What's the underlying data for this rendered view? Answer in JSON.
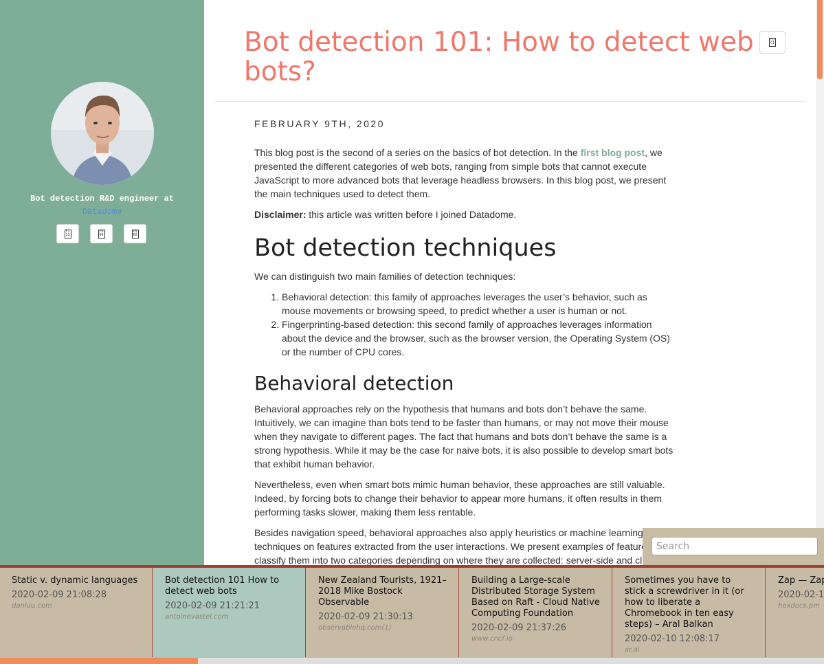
{
  "sidebar": {
    "tagline": "Bot detection R&D engineer at",
    "employer_link": "Datadome",
    "social_icons": [
      "github-icon",
      "twitter-icon",
      "linkedin-icon"
    ]
  },
  "article": {
    "title": "Bot detection 101: How to detect web bots?",
    "date": "FEBRUARY 9TH, 2020",
    "intro_before_link": "This blog post is the second of a series on the basics of bot detection. In the ",
    "intro_link": "first blog post",
    "intro_after_link": ", we presented the different categories of web bots, ranging from simple bots that cannot execute JavaScript to more advanced bots that leverage headless browsers. In this blog post, we present the main techniques used to detect them.",
    "disclaimer_label": "Disclaimer:",
    "disclaimer_text": " this article was written before I joined Datadome.",
    "h_techniques": "Bot detection techniques",
    "techniques_intro": "We can distinguish two main families of detection techniques:",
    "techniques_list": [
      "Behavioral detection: this family of approaches leverages the user’s behavior, such as mouse movements or browsing speed, to predict whether a user is human or not.",
      "Fingerprinting-based detection: this second family of approaches leverages information about the device and the browser, such as the browser version, the Operating System (OS) or the number of CPU cores."
    ],
    "h_behavioral": "Behavioral detection",
    "behavioral_p1": "Behavioral approaches rely on the hypothesis that humans and bots don’t behave the same. Intuitively, we can imagine than bots tend to be faster than humans, or may not move their mouse when they navigate to different pages. The fact that humans and bots don’t behave the same is a strong hypothesis. While it may be the case for naive bots, it is also possible to develop smart bots that exhibit human behavior.",
    "behavioral_p2": "Nevertheless, even when smart bots mimic human behavior, these approaches are still valuable. Indeed, by forcing bots to change their behavior to appear more humans, it often results in them performing tasks slower, making them less rentable.",
    "behavioral_p3": "Besides navigation speed, behavioral approaches also apply heuristics or machine learning techniques on features extracted from the user interactions. We present examples of features and classify them into two categories depending on where they are collected: server-side and client-side."
  },
  "search": {
    "placeholder": "Search"
  },
  "reading_list": [
    {
      "title": "Static v. dynamic languages",
      "time": "2020-02-09 21:08:28",
      "domain": "danluu.com"
    },
    {
      "title": "Bot detection 101 How to detect web bots",
      "time": "2020-02-09 21:21:21",
      "domain": "antoinevastel.com"
    },
    {
      "title": "New Zealand Tourists, 1921–2018 Mike Bostock Observable",
      "time": "2020-02-09 21:30:13",
      "domain": "observablehq.com(1)"
    },
    {
      "title": "Building a Large-scale Distributed Storage System Based on Raft - Cloud Native Computing Foundation",
      "time": "2020-02-09 21:37:26",
      "domain": "www.cncf.io"
    },
    {
      "title": "Sometimes you have to stick a screwdriver in it (or how to liberate a Chromebook in ten easy steps) – Aral Balkan",
      "time": "2020-02-10 12:08:17",
      "domain": "ar.al"
    },
    {
      "title": "Zap — Zap",
      "time": "2020-02-1",
      "domain": "hexdocs.pm"
    }
  ],
  "reading_progress": 0.24,
  "colors": {
    "accent": "#ee786b",
    "sidebar": "#7eae98",
    "progress": "#ee8c5b",
    "active_card": "#adc8be"
  }
}
